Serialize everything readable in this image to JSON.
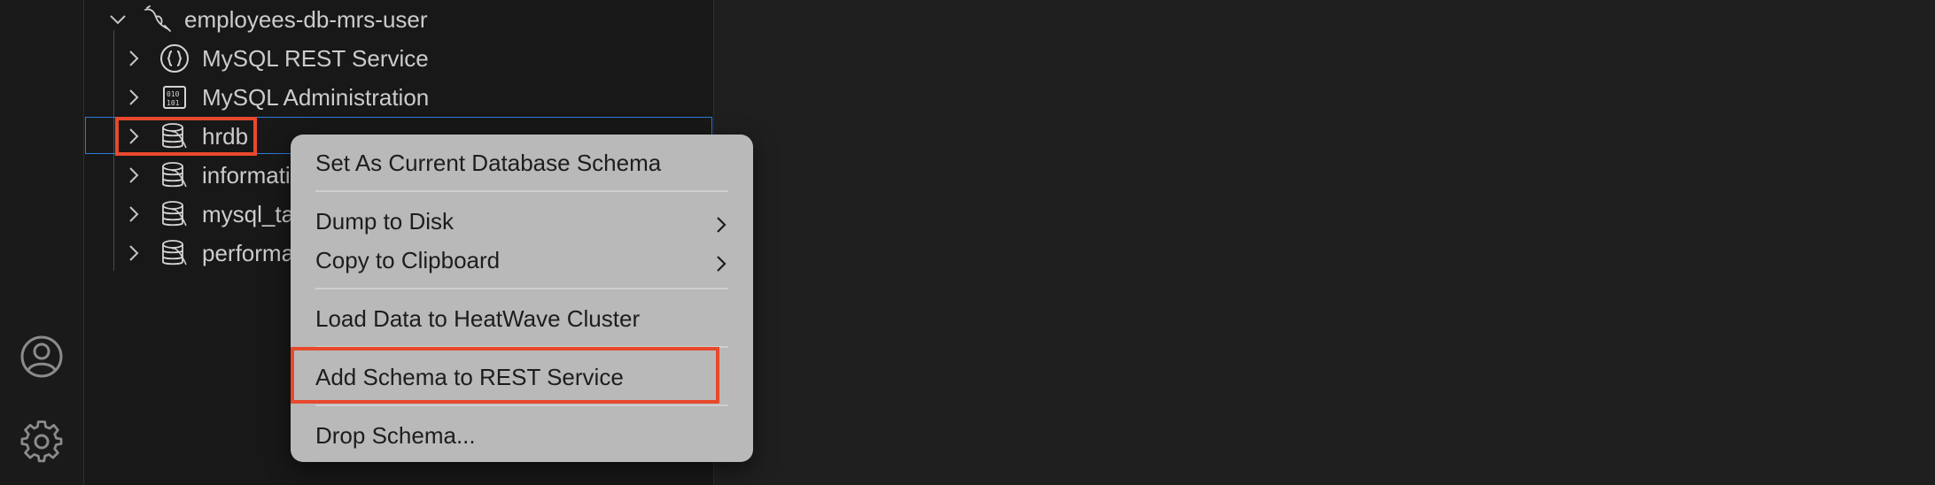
{
  "activity_bar": {
    "items": [
      {
        "icon": "account-icon"
      },
      {
        "icon": "gear-icon"
      }
    ]
  },
  "tree": {
    "connection": {
      "label": "employees-db-mrs-user",
      "icon": "mysql-dolphin-icon",
      "expanded": true
    },
    "items": [
      {
        "label": "MySQL REST Service",
        "icon": "braces-icon"
      },
      {
        "label": "MySQL Administration",
        "icon": "admin-icon"
      },
      {
        "label": "hrdb",
        "icon": "database-schema-icon",
        "selected": true
      },
      {
        "label": "informati",
        "icon": "database-schema-icon"
      },
      {
        "label": "mysql_ta",
        "icon": "database-schema-icon"
      },
      {
        "label": "performa",
        "icon": "database-schema-icon"
      }
    ]
  },
  "context_menu": {
    "items": [
      {
        "label": "Set As Current Database Schema",
        "submenu": false
      },
      {
        "label": "Dump to Disk",
        "submenu": true
      },
      {
        "label": "Copy to Clipboard",
        "submenu": true
      },
      {
        "label": "Load Data to HeatWave Cluster",
        "submenu": false
      },
      {
        "label": "Add Schema to REST Service",
        "submenu": false,
        "highlighted": true
      },
      {
        "label": "Drop Schema...",
        "submenu": false
      }
    ]
  },
  "colors": {
    "highlight_border": "#e8492d",
    "selection_border": "#2f7bdc",
    "menu_background": "#b9b9b9"
  }
}
